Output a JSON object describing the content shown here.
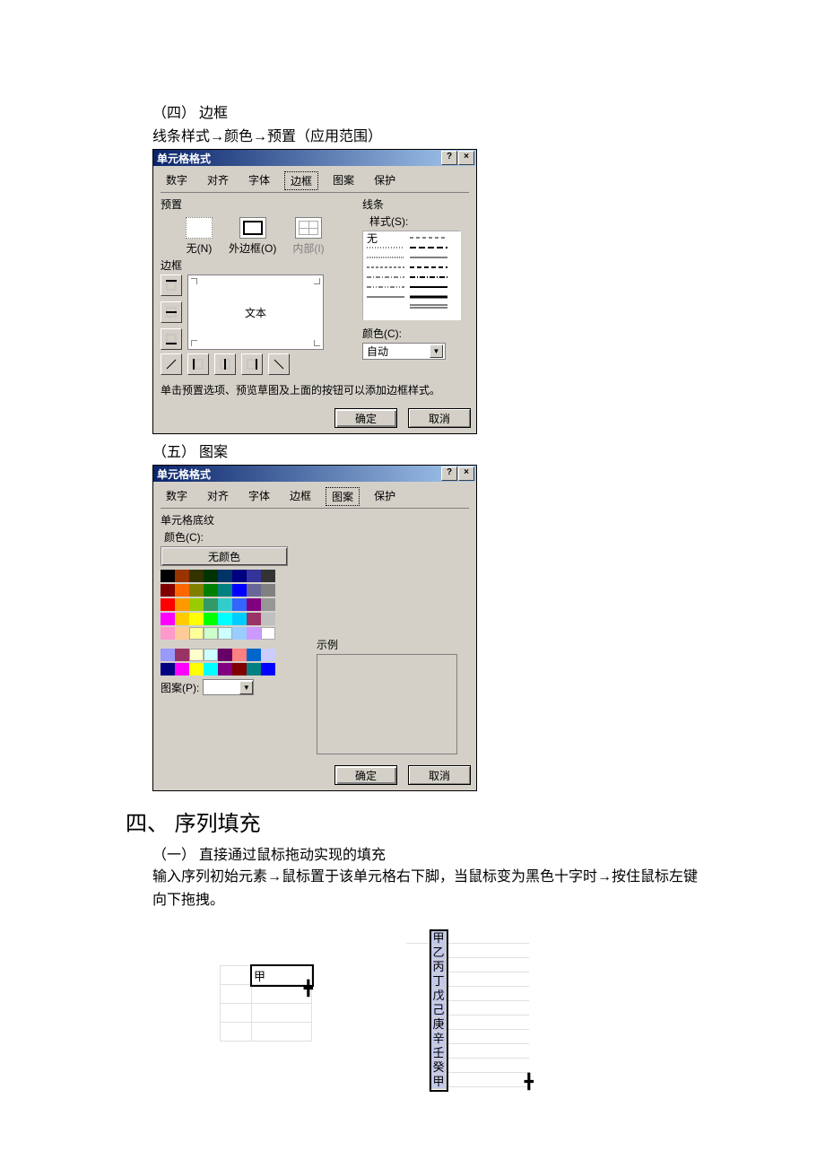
{
  "doc": {
    "s4_title": "（四） 边框",
    "s4_sub": "线条样式→颜色→预置（应用范围）",
    "s5_title": "（五） 图案",
    "big_heading": "四、 序列填充",
    "sub1": "（一） 直接通过鼠标拖动实现的填充",
    "sub1_body": "输入序列初始元素→鼠标置于该单元格右下脚，当鼠标变为黑色十字时→按住鼠标左键向下拖拽。"
  },
  "dialog1": {
    "title": "单元格格式",
    "help": "?",
    "close": "×",
    "tabs": [
      "数字",
      "对齐",
      "字体",
      "边框",
      "图案",
      "保护"
    ],
    "preset_label": "预置",
    "presets": [
      {
        "label": "无(N)"
      },
      {
        "label": "外边框(O)"
      },
      {
        "label": "内部(I)"
      }
    ],
    "border_label": "边框",
    "preview_text": "文本",
    "lines_label": "线条",
    "style_label": "样式(S):",
    "style_none": "无",
    "color_label": "颜色(C):",
    "color_value": "自动",
    "hint": "单击预置选项、预览草图及上面的按钮可以添加边框样式。",
    "ok": "确定",
    "cancel": "取消"
  },
  "dialog2": {
    "title": "单元格格式",
    "help": "?",
    "close": "×",
    "tabs": [
      "数字",
      "对齐",
      "字体",
      "边框",
      "图案",
      "保护"
    ],
    "group": "单元格底纹",
    "color_lbl": "颜色(C):",
    "no_color": "无颜色",
    "pattern_lbl": "图案(P):",
    "sample_lbl": "示例",
    "ok": "确定",
    "cancel": "取消",
    "colors_main": [
      "#000000",
      "#993300",
      "#333300",
      "#003300",
      "#003366",
      "#000080",
      "#333399",
      "#333333",
      "#800000",
      "#ff6600",
      "#808000",
      "#008000",
      "#008080",
      "#0000ff",
      "#666699",
      "#808080",
      "#ff0000",
      "#ff9900",
      "#99cc00",
      "#339966",
      "#33cccc",
      "#3366ff",
      "#800080",
      "#969696",
      "#ff00ff",
      "#ffcc00",
      "#ffff00",
      "#00ff00",
      "#00ffff",
      "#00ccff",
      "#993366",
      "#c0c0c0",
      "#ff99cc",
      "#ffcc99",
      "#ffff99",
      "#ccffcc",
      "#ccffff",
      "#99ccff",
      "#cc99ff",
      "#ffffff"
    ],
    "colors_extra": [
      "#9999ff",
      "#993366",
      "#ffffcc",
      "#ccffff",
      "#660066",
      "#ff8080",
      "#0066cc",
      "#ccccff",
      "#000080",
      "#ff00ff",
      "#ffff00",
      "#00ffff",
      "#800080",
      "#800000",
      "#008080",
      "#0000ff"
    ]
  },
  "illus": {
    "cell_value": "甲",
    "sequence": [
      "甲",
      "乙",
      "丙",
      "丁",
      "戊",
      "己",
      "庚",
      "辛",
      "壬",
      "癸",
      "甲"
    ]
  }
}
